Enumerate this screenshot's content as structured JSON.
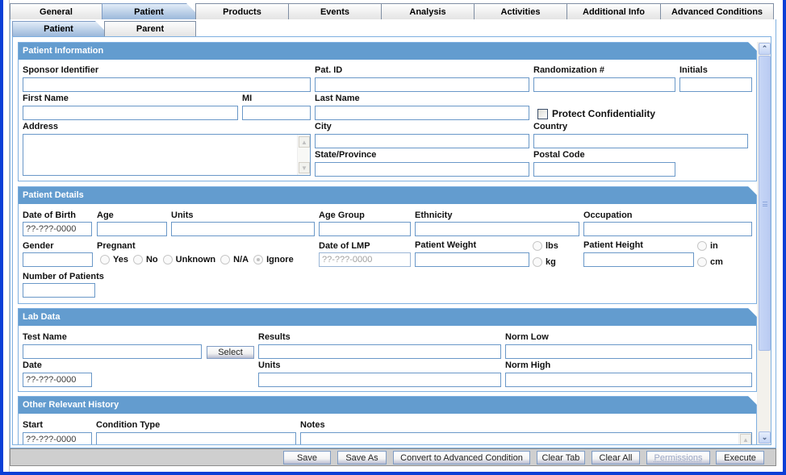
{
  "top_tabs": [
    {
      "label": "General",
      "active": false
    },
    {
      "label": "Patient",
      "active": true
    },
    {
      "label": "Products",
      "active": false
    },
    {
      "label": "Events",
      "active": false
    },
    {
      "label": "Analysis",
      "active": false
    },
    {
      "label": "Activities",
      "active": false
    },
    {
      "label": "Additional Info",
      "active": false
    },
    {
      "label": "Advanced Conditions",
      "active": false
    }
  ],
  "sub_tabs": [
    {
      "label": "Patient",
      "active": true
    },
    {
      "label": "Parent",
      "active": false
    }
  ],
  "patient_information": {
    "title": "Patient Information",
    "sponsor_identifier": {
      "label": "Sponsor Identifier",
      "value": ""
    },
    "pat_id": {
      "label": "Pat. ID",
      "value": ""
    },
    "randomization": {
      "label": "Randomization #",
      "value": ""
    },
    "initials": {
      "label": "Initials",
      "value": ""
    },
    "first_name": {
      "label": "First Name",
      "value": ""
    },
    "mi": {
      "label": "MI",
      "value": ""
    },
    "last_name": {
      "label": "Last Name",
      "value": ""
    },
    "protect_confidentiality": {
      "label": "Protect Confidentiality",
      "checked": false
    },
    "address": {
      "label": "Address",
      "value": ""
    },
    "city": {
      "label": "City",
      "value": ""
    },
    "country": {
      "label": "Country",
      "value": ""
    },
    "state_province": {
      "label": "State/Province",
      "value": ""
    },
    "postal_code": {
      "label": "Postal Code",
      "value": ""
    }
  },
  "patient_details": {
    "title": "Patient Details",
    "date_of_birth": {
      "label": "Date of Birth",
      "value": "??-???-0000"
    },
    "age": {
      "label": "Age",
      "value": ""
    },
    "units": {
      "label": "Units",
      "value": ""
    },
    "age_group": {
      "label": "Age Group",
      "value": ""
    },
    "ethnicity": {
      "label": "Ethnicity",
      "value": ""
    },
    "occupation": {
      "label": "Occupation",
      "value": ""
    },
    "gender": {
      "label": "Gender",
      "value": ""
    },
    "pregnant": {
      "label": "Pregnant",
      "options": [
        "Yes",
        "No",
        "Unknown",
        "N/A",
        "Ignore"
      ],
      "selected": "Ignore"
    },
    "date_of_lmp": {
      "label": "Date of LMP",
      "value": "??-???-0000"
    },
    "patient_weight": {
      "label": "Patient Weight",
      "value": "",
      "units": [
        "lbs",
        "kg"
      ]
    },
    "patient_height": {
      "label": "Patient Height",
      "value": "",
      "units": [
        "in",
        "cm"
      ]
    },
    "number_of_patients": {
      "label": "Number of Patients",
      "value": ""
    }
  },
  "lab_data": {
    "title": "Lab Data",
    "test_name": {
      "label": "Test Name",
      "value": ""
    },
    "select_button": "Select",
    "results": {
      "label": "Results",
      "value": ""
    },
    "norm_low": {
      "label": "Norm Low",
      "value": ""
    },
    "date": {
      "label": "Date",
      "value": "??-???-0000"
    },
    "units": {
      "label": "Units",
      "value": ""
    },
    "norm_high": {
      "label": "Norm High",
      "value": ""
    }
  },
  "other_history": {
    "title": "Other Relevant History",
    "start": {
      "label": "Start",
      "value": "??-???-0000"
    },
    "condition_type": {
      "label": "Condition Type",
      "value": ""
    },
    "notes": {
      "label": "Notes",
      "value": ""
    }
  },
  "toolbar": {
    "save": "Save",
    "save_as": "Save As",
    "convert": "Convert to Advanced Condition",
    "clear_tab": "Clear Tab",
    "clear_all": "Clear All",
    "permissions": "Permissions",
    "execute": "Execute"
  },
  "colors": {
    "section_header": "#639ccf",
    "window_frame": "#0a3fd6",
    "input_border": "#6a98c8"
  }
}
